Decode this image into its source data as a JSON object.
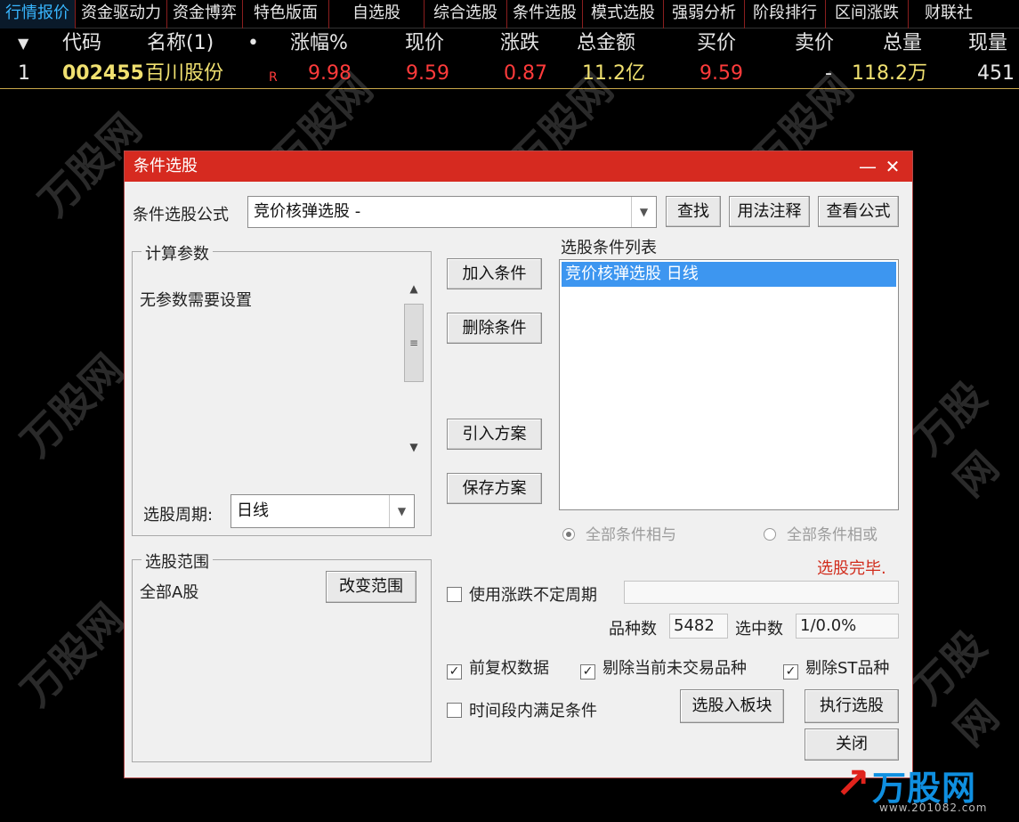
{
  "tabs": [
    "行情报价",
    "资金驱动力",
    "资金博弈",
    "特色版面",
    "自选股",
    "综合选股",
    "条件选股",
    "模式选股",
    "强弱分析",
    "阶段排行",
    "区间涨跌",
    "财联社"
  ],
  "quote_table": {
    "headers": {
      "sort": "▼",
      "code": "代码",
      "name": "名称(1)",
      "dot": "•",
      "change_pct": "涨幅%",
      "price": "现价",
      "change": "涨跌",
      "amount": "总金额",
      "bid": "买价",
      "ask": "卖价",
      "volume": "总量",
      "last_vol": "现量"
    },
    "row": {
      "index": "1",
      "code": "002455",
      "name": "百川股份",
      "flag": "R",
      "change_pct": "9.98",
      "price": "9.59",
      "change": "0.87",
      "amount": "11.2亿",
      "bid": "9.59",
      "ask": "-",
      "volume": "118.2万",
      "last_vol": "451"
    }
  },
  "dialog": {
    "title": "条件选股",
    "minimize": "—",
    "close": "✕",
    "formula_label": "条件选股公式",
    "formula_value": "竞价核弹选股  -",
    "find_button": "查找",
    "usage_button": "用法注释",
    "view_formula_button": "查看公式",
    "params_group": "计算参数",
    "params_text": "无参数需要设置",
    "period_label": "选股周期:",
    "period_value": "日线",
    "range_group": "选股范围",
    "range_value": "全部A股",
    "change_range_button": "改变范围",
    "add_condition_button": "加入条件",
    "delete_condition_button": "删除条件",
    "import_plan_button": "引入方案",
    "save_plan_button": "保存方案",
    "conditions_list_label": "选股条件列表",
    "conditions": [
      "竞价核弹选股  日线"
    ],
    "radio_and": "全部条件相与",
    "radio_or": "全部条件相或",
    "status": "选股完毕.",
    "use_variable_period": "使用涨跌不定周期",
    "variety_count_label": "品种数",
    "variety_count": "5482",
    "selected_count_label": "选中数",
    "selected_count": "1/0.0%",
    "pre_adjust": "前复权数据",
    "exclude_untraded": "剔除当前未交易品种",
    "exclude_st": "剔除ST品种",
    "within_period": "时间段内满足条件",
    "to_block_button": "选股入板块",
    "execute_button": "执行选股",
    "close_button": "关闭"
  },
  "watermark": {
    "text": "万股网"
  },
  "logo": {
    "name": "万股网",
    "url": "www.201082.com"
  }
}
